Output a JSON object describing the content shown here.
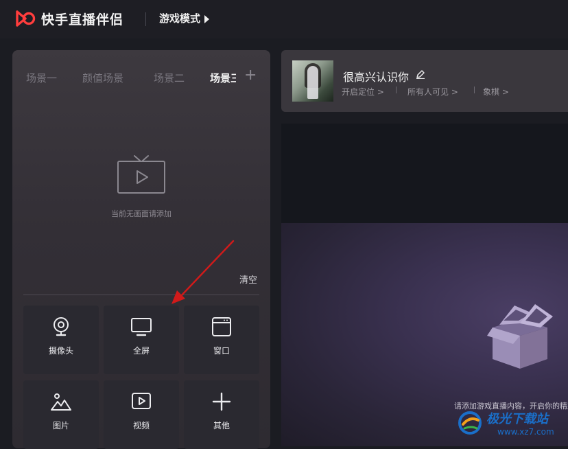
{
  "app": {
    "title": "快手直播伴侣",
    "mode_label": "游戏模式"
  },
  "scene_tabs": [
    {
      "label": "场景一"
    },
    {
      "label": "颜值场景"
    },
    {
      "label": "场景二"
    },
    {
      "label": "场景三"
    }
  ],
  "scene_tab_add": "+",
  "scene_panel": {
    "empty_text": "当前无画面请添加",
    "clear_label": "清空"
  },
  "sources": [
    {
      "label": "摄像头",
      "icon": "camera-icon"
    },
    {
      "label": "全屏",
      "icon": "monitor-icon"
    },
    {
      "label": "窗口",
      "icon": "window-icon"
    },
    {
      "label": "图片",
      "icon": "image-icon"
    },
    {
      "label": "视频",
      "icon": "video-icon"
    },
    {
      "label": "其他",
      "icon": "plus-icon"
    }
  ],
  "profile": {
    "nickname": "很高兴认识你",
    "location": "开启定位 >",
    "visibility": "所有人可见 >",
    "category": "象棋 >"
  },
  "preview": {
    "hint": "请添加游戏直播内容，开启你的精彩直播"
  },
  "watermark": {
    "text": "极光下载站",
    "url": "www.xz7.com"
  },
  "colors": {
    "accent": "#ff3d3d",
    "arrow": "#d11a1a",
    "panel": "#3a373d",
    "preview_bg": "#15171d",
    "watermark": "#1a6fc9"
  }
}
